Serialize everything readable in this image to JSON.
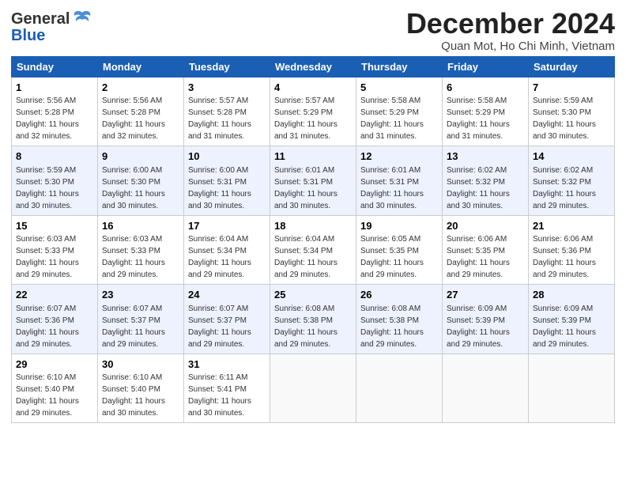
{
  "header": {
    "logo_line1": "General",
    "logo_line2": "Blue",
    "month_title": "December 2024",
    "location": "Quan Mot, Ho Chi Minh, Vietnam"
  },
  "weekdays": [
    "Sunday",
    "Monday",
    "Tuesday",
    "Wednesday",
    "Thursday",
    "Friday",
    "Saturday"
  ],
  "weeks": [
    [
      {
        "day": "1",
        "info": "Sunrise: 5:56 AM\nSunset: 5:28 PM\nDaylight: 11 hours\nand 32 minutes."
      },
      {
        "day": "2",
        "info": "Sunrise: 5:56 AM\nSunset: 5:28 PM\nDaylight: 11 hours\nand 32 minutes."
      },
      {
        "day": "3",
        "info": "Sunrise: 5:57 AM\nSunset: 5:28 PM\nDaylight: 11 hours\nand 31 minutes."
      },
      {
        "day": "4",
        "info": "Sunrise: 5:57 AM\nSunset: 5:29 PM\nDaylight: 11 hours\nand 31 minutes."
      },
      {
        "day": "5",
        "info": "Sunrise: 5:58 AM\nSunset: 5:29 PM\nDaylight: 11 hours\nand 31 minutes."
      },
      {
        "day": "6",
        "info": "Sunrise: 5:58 AM\nSunset: 5:29 PM\nDaylight: 11 hours\nand 31 minutes."
      },
      {
        "day": "7",
        "info": "Sunrise: 5:59 AM\nSunset: 5:30 PM\nDaylight: 11 hours\nand 30 minutes."
      }
    ],
    [
      {
        "day": "8",
        "info": "Sunrise: 5:59 AM\nSunset: 5:30 PM\nDaylight: 11 hours\nand 30 minutes."
      },
      {
        "day": "9",
        "info": "Sunrise: 6:00 AM\nSunset: 5:30 PM\nDaylight: 11 hours\nand 30 minutes."
      },
      {
        "day": "10",
        "info": "Sunrise: 6:00 AM\nSunset: 5:31 PM\nDaylight: 11 hours\nand 30 minutes."
      },
      {
        "day": "11",
        "info": "Sunrise: 6:01 AM\nSunset: 5:31 PM\nDaylight: 11 hours\nand 30 minutes."
      },
      {
        "day": "12",
        "info": "Sunrise: 6:01 AM\nSunset: 5:31 PM\nDaylight: 11 hours\nand 30 minutes."
      },
      {
        "day": "13",
        "info": "Sunrise: 6:02 AM\nSunset: 5:32 PM\nDaylight: 11 hours\nand 30 minutes."
      },
      {
        "day": "14",
        "info": "Sunrise: 6:02 AM\nSunset: 5:32 PM\nDaylight: 11 hours\nand 29 minutes."
      }
    ],
    [
      {
        "day": "15",
        "info": "Sunrise: 6:03 AM\nSunset: 5:33 PM\nDaylight: 11 hours\nand 29 minutes."
      },
      {
        "day": "16",
        "info": "Sunrise: 6:03 AM\nSunset: 5:33 PM\nDaylight: 11 hours\nand 29 minutes."
      },
      {
        "day": "17",
        "info": "Sunrise: 6:04 AM\nSunset: 5:34 PM\nDaylight: 11 hours\nand 29 minutes."
      },
      {
        "day": "18",
        "info": "Sunrise: 6:04 AM\nSunset: 5:34 PM\nDaylight: 11 hours\nand 29 minutes."
      },
      {
        "day": "19",
        "info": "Sunrise: 6:05 AM\nSunset: 5:35 PM\nDaylight: 11 hours\nand 29 minutes."
      },
      {
        "day": "20",
        "info": "Sunrise: 6:06 AM\nSunset: 5:35 PM\nDaylight: 11 hours\nand 29 minutes."
      },
      {
        "day": "21",
        "info": "Sunrise: 6:06 AM\nSunset: 5:36 PM\nDaylight: 11 hours\nand 29 minutes."
      }
    ],
    [
      {
        "day": "22",
        "info": "Sunrise: 6:07 AM\nSunset: 5:36 PM\nDaylight: 11 hours\nand 29 minutes."
      },
      {
        "day": "23",
        "info": "Sunrise: 6:07 AM\nSunset: 5:37 PM\nDaylight: 11 hours\nand 29 minutes."
      },
      {
        "day": "24",
        "info": "Sunrise: 6:07 AM\nSunset: 5:37 PM\nDaylight: 11 hours\nand 29 minutes."
      },
      {
        "day": "25",
        "info": "Sunrise: 6:08 AM\nSunset: 5:38 PM\nDaylight: 11 hours\nand 29 minutes."
      },
      {
        "day": "26",
        "info": "Sunrise: 6:08 AM\nSunset: 5:38 PM\nDaylight: 11 hours\nand 29 minutes."
      },
      {
        "day": "27",
        "info": "Sunrise: 6:09 AM\nSunset: 5:39 PM\nDaylight: 11 hours\nand 29 minutes."
      },
      {
        "day": "28",
        "info": "Sunrise: 6:09 AM\nSunset: 5:39 PM\nDaylight: 11 hours\nand 29 minutes."
      }
    ],
    [
      {
        "day": "29",
        "info": "Sunrise: 6:10 AM\nSunset: 5:40 PM\nDaylight: 11 hours\nand 29 minutes."
      },
      {
        "day": "30",
        "info": "Sunrise: 6:10 AM\nSunset: 5:40 PM\nDaylight: 11 hours\nand 30 minutes."
      },
      {
        "day": "31",
        "info": "Sunrise: 6:11 AM\nSunset: 5:41 PM\nDaylight: 11 hours\nand 30 minutes."
      },
      {
        "day": "",
        "info": ""
      },
      {
        "day": "",
        "info": ""
      },
      {
        "day": "",
        "info": ""
      },
      {
        "day": "",
        "info": ""
      }
    ]
  ]
}
